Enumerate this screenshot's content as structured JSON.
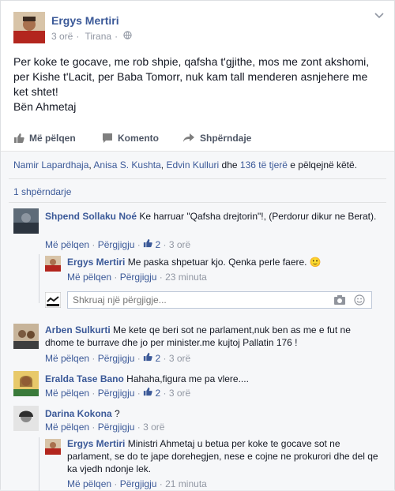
{
  "post": {
    "author": "Ergys Mertiri",
    "time": "3 orë",
    "location": "Tirana",
    "text_lines": [
      "Per koke te gocave, me rob shpie, qafsha t'gjithe, mos me zont akshomi,",
      "per Kishe t'Lacit, per Baba Tomorr, nuk kam tall menderen asnjehere me",
      "ket shtet!",
      "Bën Ahmetaj"
    ]
  },
  "actions": {
    "like": "Më pëlqen",
    "comment": "Komento",
    "share": "Shpërndaje"
  },
  "likes": {
    "names": [
      "Namir Lapardhaja",
      "Anisa S. Kushta",
      "Edvin Kulluri"
    ],
    "connector": "dhe",
    "others": "136 të tjerë",
    "suffix": "e pëlqejnë këtë."
  },
  "shares": "1 shpërndarje",
  "comment_meta": {
    "like": "Më pëlqen",
    "reply": "Përgjigju",
    "dot": "·"
  },
  "comments": [
    {
      "author": "Shpend Sollaku Noé",
      "text": "Ke harruar \"Qafsha drejtorin\"!, (Perdorur dikur ne Berat).",
      "likes": "2",
      "time": "3 orë",
      "replies": [
        {
          "author": "Ergys Mertiri",
          "text": "Me paska shpetuar kjo. Qenka perle faere. 🙂",
          "time": "23 minuta"
        }
      ],
      "reply_placeholder": "Shkruaj një përgjigje..."
    },
    {
      "author": "Arben Sulkurti",
      "text": "Me kete qe beri sot ne parlament,nuk ben as me e fut ne dhome te burrave dhe jo per minister.me kujtoj Pallatin 176 !",
      "likes": "2",
      "time": "3 orë"
    },
    {
      "author": "Eralda Tase Bano",
      "text": "Hahaha,figura me pa vlere....",
      "likes": "2",
      "time": "3 orë"
    },
    {
      "author": "Darina Kokona",
      "text": "?",
      "time": "3 orë",
      "replies": [
        {
          "author": "Ergys Mertiri",
          "text": "Ministri Ahmetaj u betua per koke te gocave sot ne parlament, se do te jape dorehegjen, nese e cojne ne prokurori dhe del qe ka vjedh ndonje lek.",
          "time": "21 minuta"
        }
      ]
    }
  ],
  "colors": {
    "link": "#3b5998",
    "meta": "#9197a3",
    "bg_social": "#f6f7f9"
  }
}
